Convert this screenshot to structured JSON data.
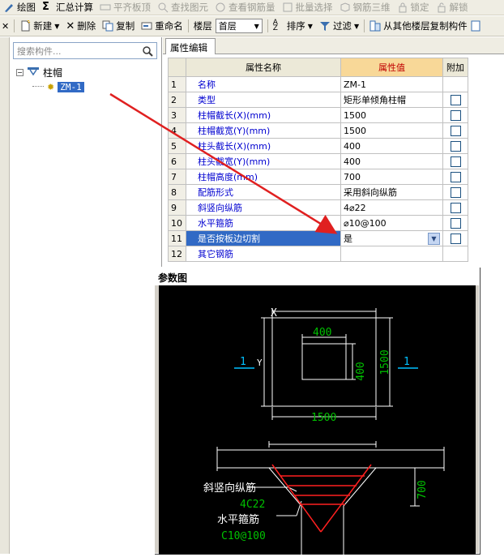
{
  "toolbar1": {
    "items": [
      {
        "label": "绘图",
        "icon": "draw-icon",
        "enabled": true
      },
      {
        "label": "汇总计算",
        "icon": "sigma-icon",
        "enabled": true
      },
      {
        "label": "平齐板顶",
        "icon": "flush-icon",
        "enabled": false
      },
      {
        "label": "查找图元",
        "icon": "find-icon",
        "enabled": false
      },
      {
        "label": "查看钢筋量",
        "icon": "rebar-view-icon",
        "enabled": false
      },
      {
        "label": "批量选择",
        "icon": "batch-icon",
        "enabled": false
      },
      {
        "label": "钢筋三维",
        "icon": "rebar-3d-icon",
        "enabled": false
      },
      {
        "label": "锁定",
        "icon": "lock-icon",
        "enabled": false
      },
      {
        "label": "解锁",
        "icon": "unlock-icon",
        "enabled": false
      }
    ]
  },
  "toolbar2": {
    "new_label": "新建",
    "delete_label": "删除",
    "copy_label": "复制",
    "rename_label": "重命名",
    "floor_label": "楼层",
    "floor_value": "首层",
    "sort_label": "排序",
    "filter_label": "过滤",
    "copy_from_floor_label": "从其他楼层复制构件"
  },
  "left_panel": {
    "search_placeholder": "搜索构件...",
    "tree_root": "柱帽",
    "tree_child": "ZM-1"
  },
  "tab": {
    "label": "属性编辑"
  },
  "grid": {
    "headers": {
      "name": "属性名称",
      "value": "属性值",
      "extra": "附加"
    },
    "rows": [
      {
        "num": "1",
        "name": "名称",
        "value": "ZM-1",
        "check": false
      },
      {
        "num": "2",
        "name": "类型",
        "value": "矩形单倾角柱帽",
        "check": true
      },
      {
        "num": "3",
        "name": "柱帽截长(X)(mm)",
        "value": "1500",
        "check": true
      },
      {
        "num": "4",
        "name": "柱帽截宽(Y)(mm)",
        "value": "1500",
        "check": true
      },
      {
        "num": "5",
        "name": "柱头截长(X)(mm)",
        "value": "400",
        "check": true
      },
      {
        "num": "6",
        "name": "柱头截宽(Y)(mm)",
        "value": "400",
        "check": true
      },
      {
        "num": "7",
        "name": "柱帽高度(mm)",
        "value": "700",
        "check": true
      },
      {
        "num": "8",
        "name": "配筋形式",
        "value": "采用斜向纵筋",
        "check": true
      },
      {
        "num": "9",
        "name": "斜竖向纵筋",
        "value": "4⌀22",
        "check": true
      },
      {
        "num": "10",
        "name": "水平箍筋",
        "value": "⌀10@100",
        "check": true
      },
      {
        "num": "11",
        "name": "是否按板边切割",
        "value": "是",
        "check": true,
        "selected": true
      },
      {
        "num": "12",
        "name": "其它钢筋",
        "value": "",
        "check": false
      }
    ]
  },
  "param_window": {
    "title": "参数图",
    "figure": {
      "dim_x": "X",
      "dim_y": "Y",
      "dim_top_400": "400",
      "dim_side_400": "400",
      "dim_right_1500": "1500",
      "dim_bottom_1500": "1500",
      "section_left": "1",
      "section_right": "1",
      "label_slant_rebar": "斜竖向纵筋",
      "label_slant_rebar_spec": "4C22",
      "label_stirrup": "水平箍筋",
      "label_stirrup_spec": "C10@100",
      "dim_height_700": "700"
    }
  },
  "colors": {
    "toolbar_bg": "#efede3",
    "selection_blue": "#316ac5",
    "value_header_bg": "#f8d898",
    "value_header_text": "#c00000",
    "name_text": "#0000d0",
    "annotation_red": "#e02020",
    "cad_white": "#ffffff",
    "cad_green": "#00c000",
    "cad_cyan": "#00c0ff",
    "cad_red": "#ff2020"
  }
}
